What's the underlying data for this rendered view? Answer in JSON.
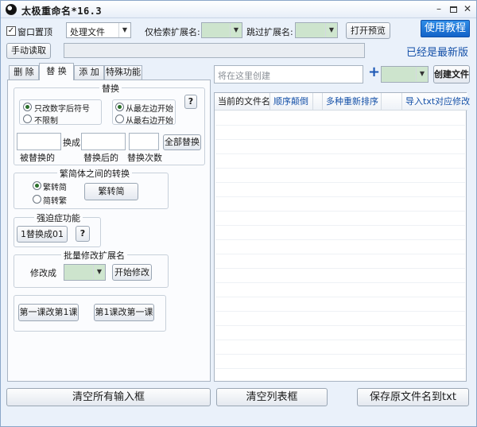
{
  "window": {
    "title": "太极重命名*16.3",
    "minimize": "–",
    "close": "✕"
  },
  "toolbar": {
    "always_on_top_label": "窗口置顶",
    "always_on_top_checked": true,
    "mode_select_value": "处理文件",
    "search_ext_label": "仅检索扩展名:",
    "skip_ext_label": "跳过扩展名:",
    "preview_button": "打开预览",
    "tutorial_button": "使用教程",
    "manual_read_button": "手动读取",
    "version_status": "已经是最新版"
  },
  "tabs": [
    {
      "label": "删 除",
      "active": false
    },
    {
      "label": "替 换",
      "active": true
    },
    {
      "label": "添 加",
      "active": false
    },
    {
      "label": "特殊功能",
      "active": false
    }
  ],
  "replace_group": {
    "title": "替换",
    "radio_digits_only": "只改数字后符号",
    "radio_unlimited": "不限制",
    "radio_from_left": "从最左边开始",
    "radio_from_right": "从最右边开始",
    "help_button": "?",
    "swap_label": "换成",
    "replace_all_button": "全部替换",
    "caption_before": "被替换的",
    "caption_after": "替换后的",
    "caption_count": "替换次数"
  },
  "trad_simp_group": {
    "title": "繁简体之间的转换",
    "radio_trad_to_simp": "繁转简",
    "radio_simp_to_trad": "简转繁",
    "convert_button": "繁转简"
  },
  "ocd_group": {
    "title": "强迫症功能",
    "replace_button": "1替换成01",
    "help_button": "?"
  },
  "ext_group": {
    "title": "批量修改扩展名",
    "change_to_label": "修改成",
    "start_button": "开始修改"
  },
  "lesson_buttons": {
    "first_button": "第一课改第1课",
    "second_button": "第1课改第一课"
  },
  "right_pane": {
    "create_input_placeholder": "将在这里创建",
    "plus_icon": "+",
    "create_file_button": "创建文件",
    "list_headers": [
      "当前的文件名",
      "顺序颠倒",
      "多种重新排序",
      "导入txt对应修改"
    ]
  },
  "bottom_buttons": {
    "clear_inputs": "清空所有输入框",
    "clear_list": "清空列表框",
    "save_names": "保存原文件名到txt"
  }
}
